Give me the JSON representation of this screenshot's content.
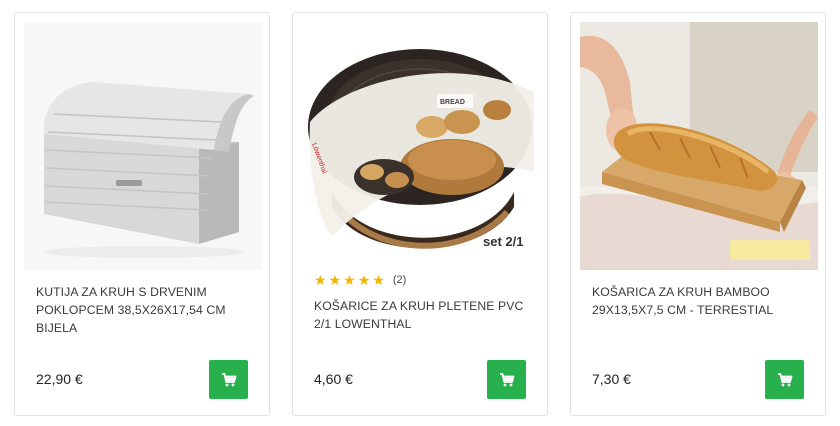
{
  "products": [
    {
      "title": "KUTIJA ZA KRUH S DRVENIM POKLOPCEM 38,5x26x17,54 CM BIJELA",
      "price": "22,90 €",
      "image_icon": "bread-box-icon"
    },
    {
      "title": "KOŠARICE ZA KRUH PLETENE PVC 2/1 LOWENTHAL",
      "price": "4,60 €",
      "rating_stars": 5,
      "rating_count": "(2)",
      "image_text": "set 2/1",
      "image_icon": "bread-basket-icon"
    },
    {
      "title": "KOŠARICA ZA KRUH BAMBOO 29x13,5x7,5 cm - TERRESTIAL",
      "price": "7,30 €",
      "image_icon": "bamboo-tray-icon"
    }
  ],
  "colors": {
    "cart_button": "#27b04b",
    "star": "#f5b301"
  },
  "cart_icon": "shopping-cart-icon"
}
